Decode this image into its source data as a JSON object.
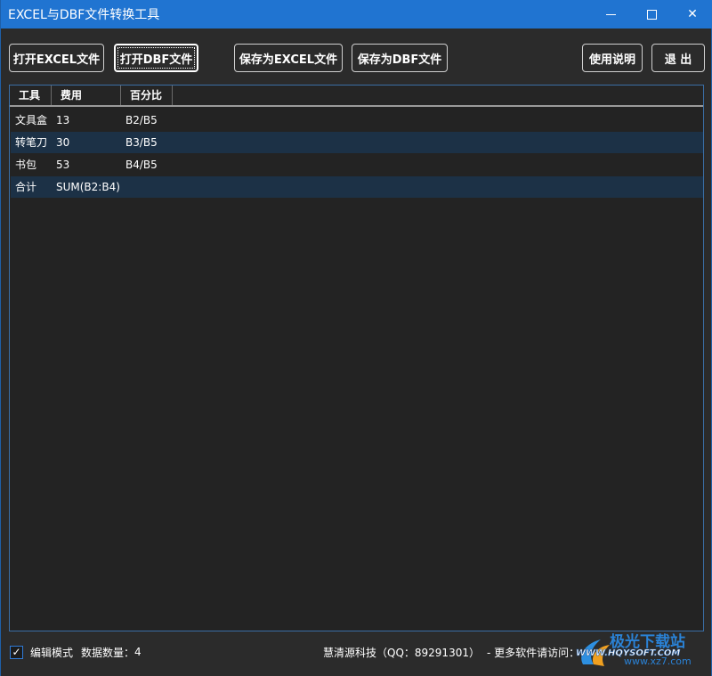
{
  "window": {
    "title": "EXCEL与DBF文件转换工具",
    "min_icon": "minimize-icon",
    "max_icon": "maximize-icon",
    "close_icon": "close-icon",
    "close_glyph": "✕"
  },
  "toolbar": {
    "open_excel": "打开EXCEL文件",
    "open_dbf": "打开DBF文件",
    "save_excel": "保存为EXCEL文件",
    "save_dbf": "保存为DBF文件",
    "help": "使用说明",
    "exit": "退 出"
  },
  "grid": {
    "columns": [
      "工具",
      "费用",
      "百分比"
    ],
    "rows": [
      [
        "文具盒",
        "13",
        "B2/B5"
      ],
      [
        "转笔刀",
        "30",
        "B3/B5"
      ],
      [
        "书包",
        "53",
        "B4/B5"
      ],
      [
        "合计",
        "SUM(B2:B4)",
        ""
      ]
    ]
  },
  "status": {
    "edit_mode_checked": true,
    "check_glyph": "✓",
    "edit_mode_label": "编辑模式",
    "count_label": "数据数量：",
    "count_value": "4",
    "company": "慧清源科技（QQ：89291301）",
    "more_software": "- 更多软件请访问："
  },
  "watermark": {
    "brand": "极光下载站",
    "url": "www.xz7.com",
    "overlay": "WWW.HQYSOFT.COM"
  },
  "colors": {
    "titlebar": "#2074d1",
    "background": "#2b2b2b",
    "alt_row": "#1c3146",
    "grid_border": "#3a6ea5"
  }
}
